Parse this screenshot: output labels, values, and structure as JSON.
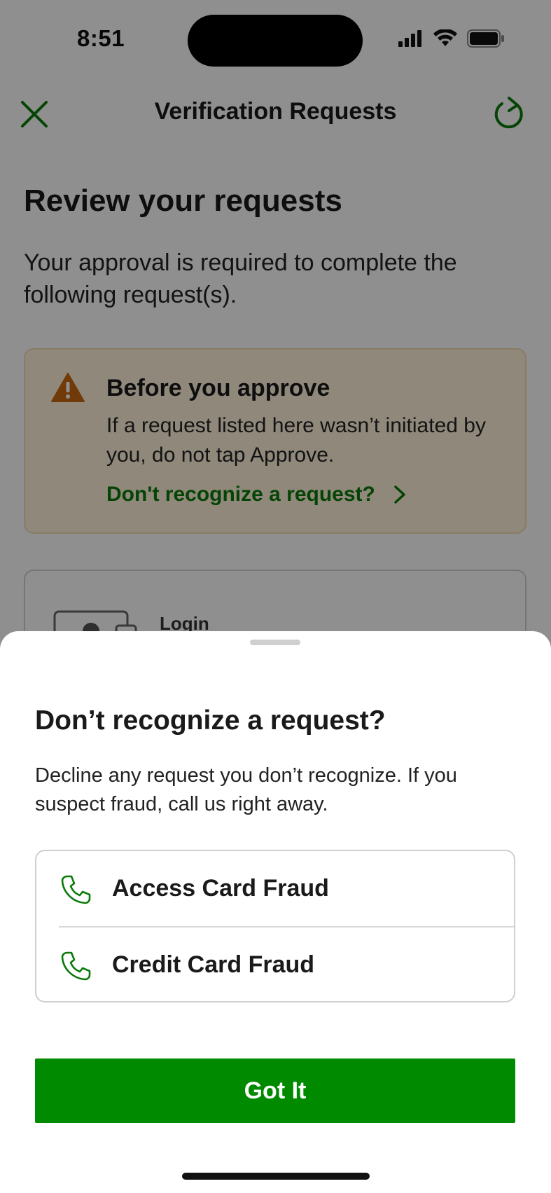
{
  "status_bar": {
    "time": "8:51"
  },
  "nav": {
    "title": "Verification Requests"
  },
  "page": {
    "heading": "Review your requests",
    "description": "Your approval is required to complete the following request(s)."
  },
  "warning": {
    "title": "Before you approve",
    "body": "If a request listed here wasn’t initiated by you, do not tap Approve.",
    "link": "Don't recognize a request?"
  },
  "request_card": {
    "label": "Login"
  },
  "sheet": {
    "title": "Don’t recognize a request?",
    "description": "Decline any request you don’t recognize. If you suspect fraud, call us right away.",
    "contacts": [
      {
        "label": "Access Card Fraud"
      },
      {
        "label": "Credit Card Fraud"
      }
    ],
    "button": "Got It"
  },
  "colors": {
    "accent": "#008a00",
    "warning_bg": "#fff3dc",
    "warning_icon": "#c8690f"
  }
}
